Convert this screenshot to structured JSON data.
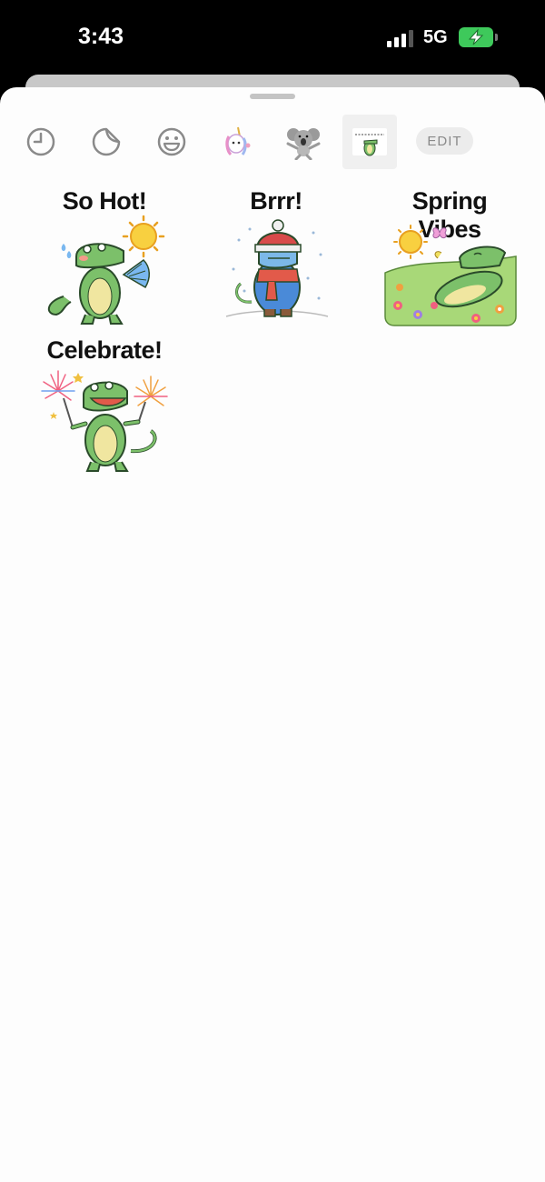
{
  "status_bar": {
    "time": "3:43",
    "network": "5G",
    "signal_bars": 3,
    "battery_state": "charging",
    "battery_color": "#3ec95b"
  },
  "toolbar": {
    "icons": [
      "clock-icon",
      "sticker-icon",
      "emoji-face-icon",
      "unicorn-sticker-pack-icon",
      "koala-sticker-pack-icon",
      "crocodile-sticker-pack-icon"
    ],
    "selected_pack": "crocodile-sticker-pack-icon",
    "edit_label": "EDIT"
  },
  "stickers": [
    {
      "title": "So Hot!"
    },
    {
      "title": "Brrr!"
    },
    {
      "title": "Spring Vibes"
    },
    {
      "title": "Celebrate!"
    }
  ]
}
